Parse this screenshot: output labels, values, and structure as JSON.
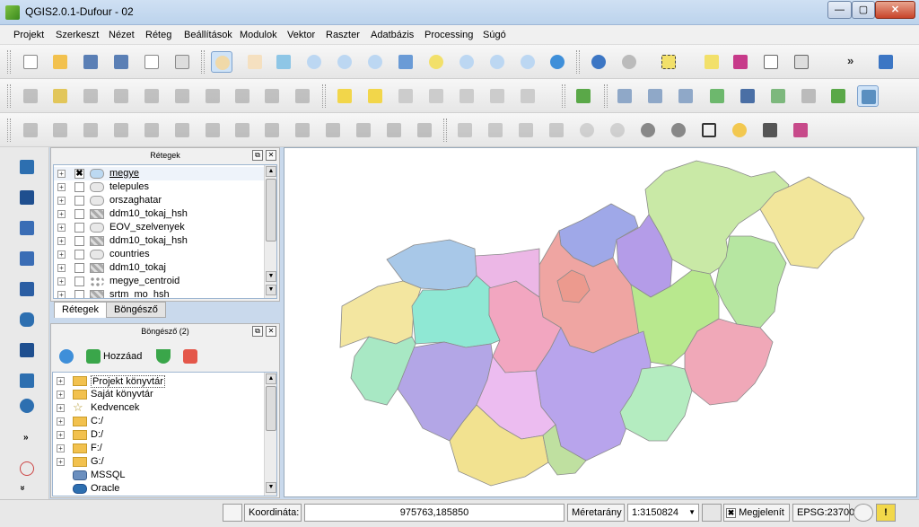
{
  "window": {
    "title": "QGIS2.0.1-Dufour - 02",
    "min": "—",
    "max": "▢",
    "close": "✕"
  },
  "menu": [
    "Projekt",
    "Szerkeszt",
    "Nézet",
    "Réteg",
    "Beállítások",
    "Modulok",
    "Vektor",
    "Raszter",
    "Adatbázis",
    "Processing",
    "Súgó"
  ],
  "toolbar_more": "»",
  "layers_panel": {
    "title": "Rétegek",
    "float_btn": "⧉",
    "close_btn": "✕",
    "layers": [
      {
        "name": "megye",
        "checked": true,
        "kind": "polygon"
      },
      {
        "name": "telepules",
        "checked": false,
        "kind": "polygon"
      },
      {
        "name": "orszaghatar",
        "checked": false,
        "kind": "polygon"
      },
      {
        "name": "ddm10_tokaj_hsh",
        "checked": false,
        "kind": "raster"
      },
      {
        "name": "EOV_szelvenyek",
        "checked": false,
        "kind": "polygon"
      },
      {
        "name": "ddm10_tokaj_hsh",
        "checked": false,
        "kind": "raster"
      },
      {
        "name": "countries",
        "checked": false,
        "kind": "polygon"
      },
      {
        "name": "ddm10_tokaj",
        "checked": false,
        "kind": "raster"
      },
      {
        "name": "megye_centroid",
        "checked": false,
        "kind": "point"
      },
      {
        "name": "srtm_mo_hsh",
        "checked": false,
        "kind": "raster"
      }
    ],
    "check_mark": "✖",
    "expand": "+"
  },
  "tabs": [
    "Rétegek",
    "Böngésző"
  ],
  "browser_panel": {
    "title": "Böngésző (2)",
    "add_label": "Hozzáad",
    "items": [
      "Projekt könyvtár",
      "Saját könyvtár",
      "Kedvencek",
      "C:/",
      "D:/",
      "F:/",
      "G:/",
      "MSSQL",
      "Oracle"
    ]
  },
  "scroll_up": "▲",
  "scroll_down": "▼",
  "collapse": "»",
  "status": {
    "coord_label": "Koordináta:",
    "coord_value": "975763,185850",
    "scale_label": "Méretarány",
    "scale_value": "1:3150824",
    "dropdown": "▼",
    "render_check": "✖",
    "render_label": "Megjelenít",
    "crs": "EPSG:23700",
    "warning": "!"
  },
  "map": {
    "county_colors": [
      "#c9e9a6",
      "#b6e6a1",
      "#f2e69b",
      "#9fa8e8",
      "#b49ce8",
      "#efa5a2",
      "#ec9a8e",
      "#ecb7e6",
      "#a8c8e8",
      "#b8e88e",
      "#f3e6a0",
      "#8fe8d4",
      "#f2a6c0",
      "#b8a4ec",
      "#b3a6e6",
      "#ecbcf0",
      "#f2e290",
      "#b4ecc0",
      "#f0a8b8",
      "#a8e8c4",
      "#bfe0a0"
    ],
    "stroke": "#8c8c8c"
  }
}
